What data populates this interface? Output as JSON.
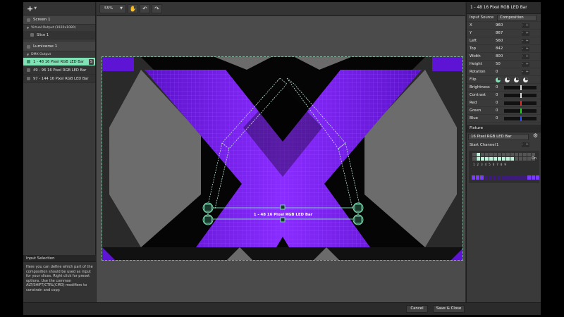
{
  "left_panel": {
    "add_label": "+",
    "tree": {
      "screen": {
        "label": "Screen 1",
        "sublabel": "Virtual Output (1920x1080)",
        "slice": "Slice 1"
      },
      "lumiverse": {
        "label": "Lumiverse 1",
        "sublabel": "DMX Output",
        "items": [
          "1 - 48 16 Pixel RGB LED Bar",
          "49 - 96 16 Pixel RGB LED Bar",
          "97 - 144 16 Pixel RGB LED Bar"
        ],
        "selected_badge": "S"
      }
    },
    "help": {
      "title": "Input Selection",
      "text": "Here you can define which part of the composition should be used as input for your slices. Right click for preset options. Use the common ALT/SHIFT/CTRL(CMD) modifiers to constrain and copy."
    }
  },
  "toolbar": {
    "zoom": "55%"
  },
  "canvas": {
    "selection_label": "1 - 48 16 Pixel RGB LED Bar"
  },
  "right_panel": {
    "title": "1 - 48 16 Pixel RGB LED Bar",
    "input_source_label": "Input Source",
    "input_source_value": "Composition",
    "props": [
      {
        "label": "X",
        "value": "960"
      },
      {
        "label": "Y",
        "value": "867"
      },
      {
        "label": "Left",
        "value": "560"
      },
      {
        "label": "Top",
        "value": "842"
      },
      {
        "label": "Width",
        "value": "800"
      },
      {
        "label": "Height",
        "value": "50"
      },
      {
        "label": "Rotation",
        "value": "0"
      }
    ],
    "flip_label": "Flip",
    "sliders": [
      {
        "label": "Brightness",
        "value": "0",
        "color": "#dddddd"
      },
      {
        "label": "Contrast",
        "value": "0",
        "color": "#dddddd"
      },
      {
        "label": "Red",
        "value": "0",
        "color": "#e03030"
      },
      {
        "label": "Green",
        "value": "0",
        "color": "#30d030"
      },
      {
        "label": "Blue",
        "value": "0",
        "color": "#3050ff"
      }
    ],
    "fixture_header": "Fixture",
    "fixture_value": "16 Pixel RGB LED Bar",
    "start_channel_label": "Start Channel",
    "start_channel_value": "1",
    "on_label": "On",
    "channel_numbers": [
      "1",
      "2",
      "3",
      "4",
      "5",
      "6",
      "7",
      "8",
      "9"
    ],
    "pm_label": "- +"
  },
  "buttons": {
    "cancel": "Cancel",
    "save": "Save & Close"
  },
  "colors": {
    "accent": "#7fe3b6",
    "purple": "#7a1fff"
  }
}
